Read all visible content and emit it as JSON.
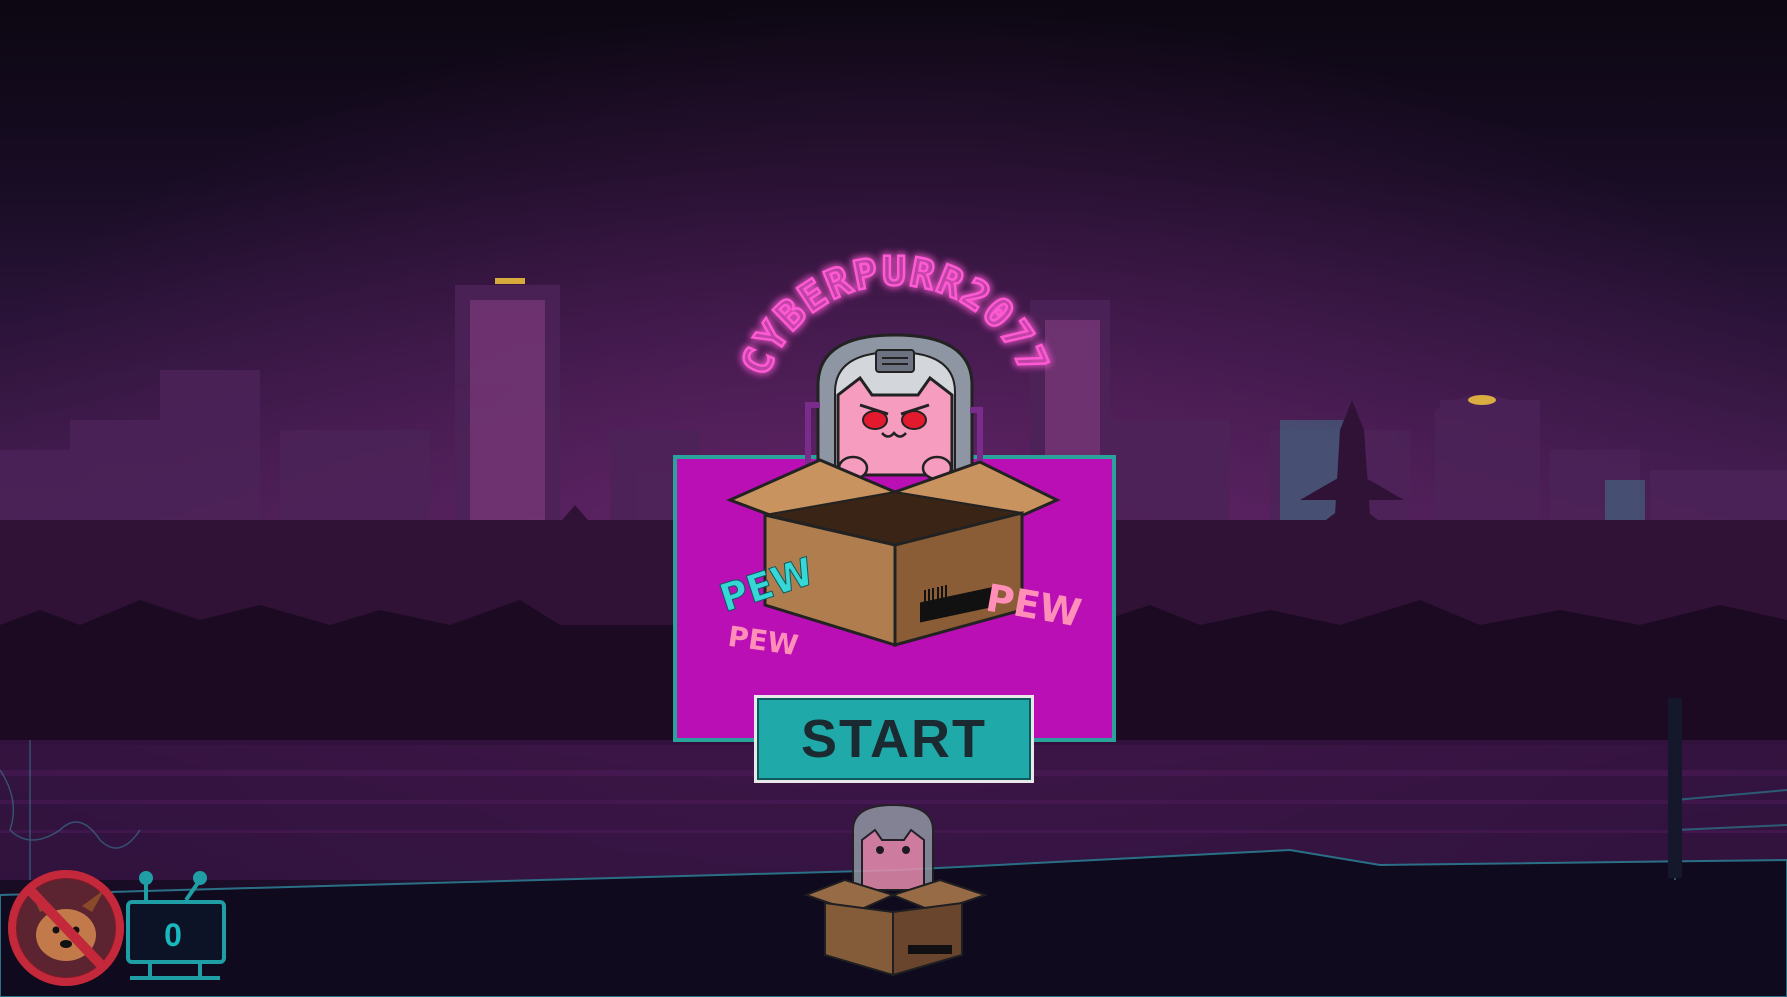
{
  "game": {
    "title": "CYBERPURR2077",
    "start_label": "START",
    "sfx_words": [
      "PEW",
      "PEW",
      "PEW"
    ],
    "score": "0"
  },
  "icons": {
    "no_dog": "no-dog-icon",
    "cat_mascot": "cat-in-box-icon",
    "counter_frame": "tv-frame-icon"
  },
  "colors": {
    "neon_pink": "#ff3cc8",
    "panel_magenta": "#b90fb4",
    "teal": "#1fa9a8",
    "box_brown": "#b07d4f"
  }
}
